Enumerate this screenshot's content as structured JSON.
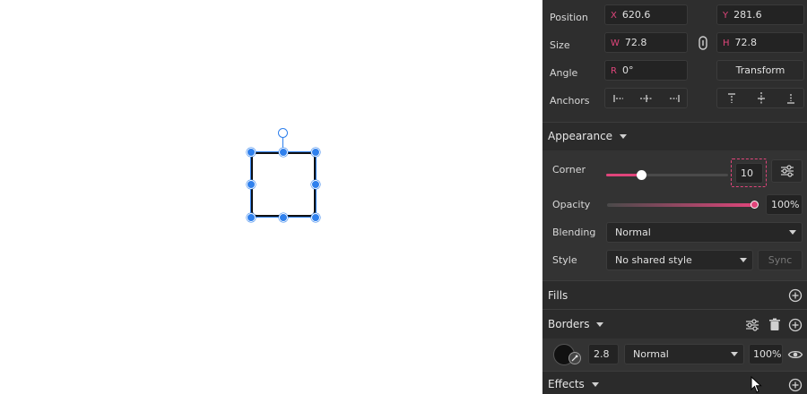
{
  "geometry": {
    "position_label": "Position",
    "x_prefix": "X",
    "x_value": "620.6",
    "y_prefix": "Y",
    "y_value": "281.6",
    "size_label": "Size",
    "w_prefix": "W",
    "w_value": "72.8",
    "h_prefix": "H",
    "h_value": "72.8",
    "angle_label": "Angle",
    "r_prefix": "R",
    "r_value": "0°",
    "transform_label": "Transform",
    "anchors_label": "Anchors"
  },
  "appearance": {
    "title": "Appearance",
    "corner_label": "Corner",
    "corner_value": "10",
    "corner_fraction": 0.29,
    "opacity_label": "Opacity",
    "opacity_value": "100%",
    "opacity_fraction": 1.0,
    "blending_label": "Blending",
    "blending_value": "Normal",
    "style_label": "Style",
    "style_value": "No shared style",
    "sync_label": "Sync"
  },
  "fills": {
    "title": "Fills"
  },
  "borders": {
    "title": "Borders",
    "thickness": "2.8",
    "blend": "Normal",
    "opacity": "100%",
    "color": "#111111"
  },
  "effects": {
    "title": "Effects"
  },
  "colors": {
    "accent": "#e0457b",
    "selection": "#2f80ed"
  }
}
